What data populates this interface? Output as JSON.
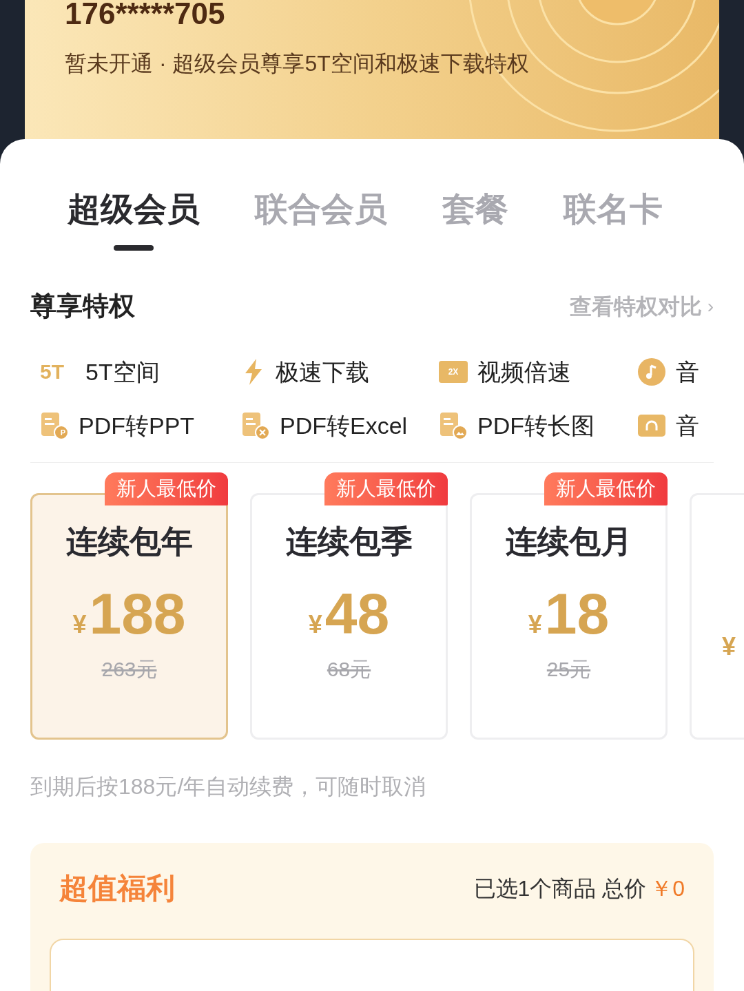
{
  "header": {
    "phone": "176*****705",
    "status": "暂未开通 · 超级会员尊享5T空间和极速下载特权"
  },
  "tabs": [
    {
      "label": "超级会员",
      "selected": true
    },
    {
      "label": "联合会员",
      "selected": false
    },
    {
      "label": "套餐",
      "selected": false
    },
    {
      "label": "联名卡",
      "selected": false
    }
  ],
  "perks_section": {
    "title": "尊享特权",
    "link": "查看特权对比",
    "arrow": "›"
  },
  "perks": [
    {
      "kind": "space",
      "label": "5T空间",
      "icon_text": "5T"
    },
    {
      "kind": "bolt",
      "label": "极速下载"
    },
    {
      "kind": "speed",
      "label": "视频倍速",
      "icon_text": "2X"
    },
    {
      "kind": "music",
      "label": "音"
    },
    {
      "kind": "doc",
      "label": "PDF转PPT",
      "icon_text": "P"
    },
    {
      "kind": "doc-x",
      "label": "PDF转Excel"
    },
    {
      "kind": "doc-img",
      "label": "PDF转长图"
    },
    {
      "kind": "audio",
      "label": "音"
    }
  ],
  "plans": [
    {
      "badge": "新人最低价",
      "title": "连续包年",
      "currency": "¥",
      "price": "188",
      "original": "263元",
      "selected": true
    },
    {
      "badge": "新人最低价",
      "title": "连续包季",
      "currency": "¥",
      "price": "48",
      "original": "68元",
      "selected": false
    },
    {
      "badge": "新人最低价",
      "title": "连续包月",
      "currency": "¥",
      "price": "18",
      "original": "25元",
      "selected": false
    },
    {
      "currency": "¥",
      "selected": false
    }
  ],
  "renew_note": "到期后按188元/年自动续费，可随时取消",
  "benefits": {
    "title": "超值福利",
    "summary": "已选1个商品 总价",
    "total": "￥0"
  }
}
